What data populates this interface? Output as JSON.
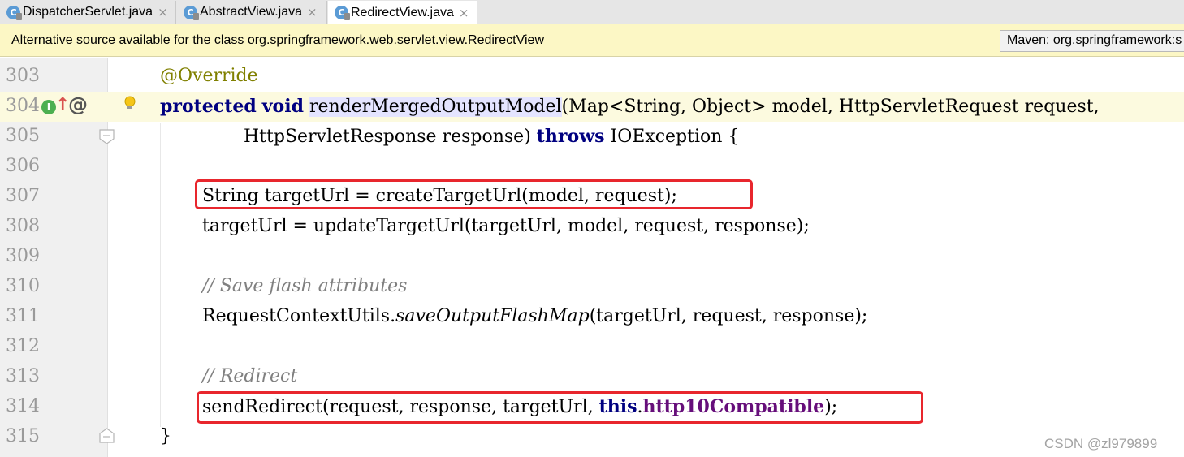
{
  "tabs": [
    {
      "label": "DispatcherServlet.java",
      "icon": "java-class-icon",
      "active": false
    },
    {
      "label": "AbstractView.java",
      "icon": "java-class-icon",
      "active": false
    },
    {
      "label": "RedirectView.java",
      "icon": "java-class-icon",
      "active": true
    }
  ],
  "banner": {
    "text": "Alternative source available for the class org.springframework.web.servlet.view.RedirectView",
    "maven_button": "Maven: org.springframework:s"
  },
  "lines": {
    "l303": {
      "num": "303",
      "annotation": "@Override"
    },
    "l304": {
      "num": "304",
      "kw1": "protected",
      "kw2": "void",
      "method": "renderMergedOutputModel",
      "rest": "(Map<String, Object> model, HttpServletRequest request,"
    },
    "l305": {
      "num": "305",
      "pre": "HttpServletResponse response) ",
      "kw": "throws",
      "post": " IOException {"
    },
    "l306": {
      "num": "306"
    },
    "l307": {
      "num": "307",
      "code": "String targetUrl = createTargetUrl(model, request);"
    },
    "l308": {
      "num": "308",
      "code": "targetUrl = updateTargetUrl(targetUrl, model, request, response);"
    },
    "l309": {
      "num": "309"
    },
    "l310": {
      "num": "310",
      "comment": "// Save flash attributes"
    },
    "l311": {
      "num": "311",
      "pre": "RequestContextUtils.",
      "italic": "saveOutputFlashMap",
      "post": "(targetUrl, request, response);"
    },
    "l312": {
      "num": "312"
    },
    "l313": {
      "num": "313",
      "comment": "// Redirect"
    },
    "l314": {
      "num": "314",
      "pre": "sendRedirect(request, response, targetUrl, ",
      "kw": "this",
      "dot": ".",
      "field": "http10Compatible",
      "post": ");"
    },
    "l315": {
      "num": "315",
      "code": "}"
    }
  },
  "gutter_icons": {
    "implements": "I",
    "at": "@"
  },
  "watermark": "CSDN @zl979899",
  "colors": {
    "keyword": "#000080",
    "annotation": "#808000",
    "comment": "#808080",
    "field": "#660e7a",
    "highlight_box": "#e8262d",
    "banner_bg": "#fcf7c5"
  }
}
